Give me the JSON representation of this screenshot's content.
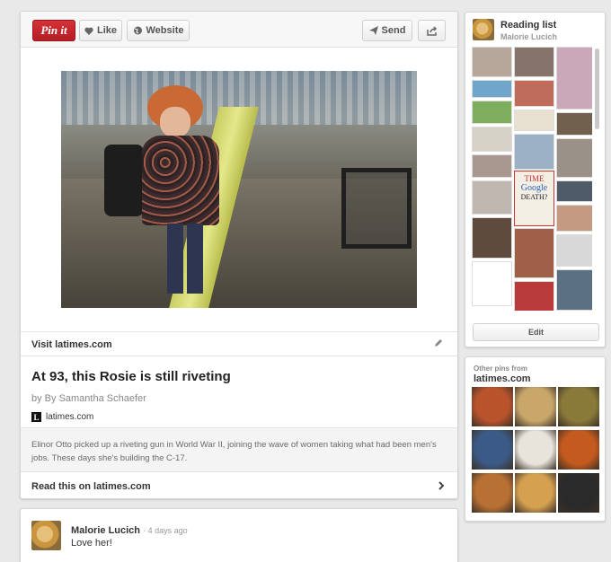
{
  "toolbar": {
    "pinit_label": "Pin it",
    "like_label": "Like",
    "website_label": "Website",
    "send_label": "Send"
  },
  "pin": {
    "visit_label": "Visit latimes.com",
    "title": "At 93, this Rosie is still riveting",
    "byline": "by By Samantha Schaefer",
    "source_logo": "L",
    "source_name": "latimes.com",
    "description": "Elinor Otto picked up a riveting gun in World War II, joining the wave of women taking what had been men's jobs. These days she's building the C-17.",
    "read_label": "Read this on latimes.com"
  },
  "comment": {
    "author": "Malorie Lucich",
    "time": "· 4 days ago",
    "text": "Love her!"
  },
  "board": {
    "name": "Reading list",
    "owner": "Malorie Lucich",
    "edit_label": "Edit",
    "time_cover_line1": "TIME",
    "time_cover_line2": "Google",
    "time_cover_line3": "DEATH?",
    "tile_colors": [
      "#b7a79a",
      "#6fa6c9",
      "#7cae5c",
      "#d6d2c8",
      "#a89890",
      "#c0b8b0",
      "#5e4b3e",
      "#ffffff",
      "#86746a",
      "#c06c5a",
      "#e8e0d0",
      "#9cb0c6",
      "#a06048",
      "#b83a3a",
      "#7c8fa0",
      "#bdb09c",
      "#caa8b8",
      "#72604e",
      "#9a9288",
      "#4f5b68",
      "#c49a82",
      "#d8d8d8",
      "#5b7082",
      "#a8b4c0",
      "#dcd4c0",
      "#8a6a52",
      "#6a7c8e"
    ]
  },
  "other_pins": {
    "heading_small": "Other pins from",
    "heading_source": "latimes.com",
    "tile_colors": [
      "#b8532c",
      "#c9a76a",
      "#8a7a3a",
      "#3b5a86",
      "#e8e4dc",
      "#c45a1e",
      "#b87034",
      "#d5a050",
      "#2a2a2a"
    ]
  }
}
